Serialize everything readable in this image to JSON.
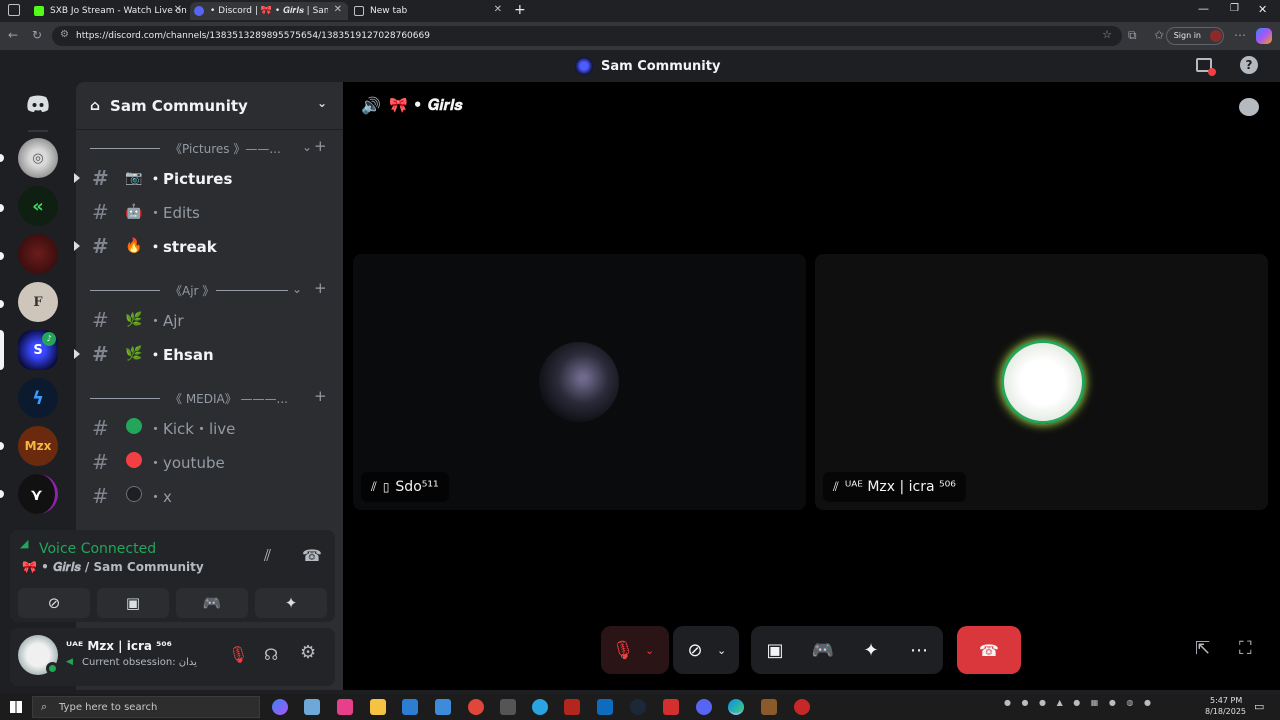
{
  "browser": {
    "tabs": [
      {
        "title": "SXB Jo Stream - Watch Live on",
        "active": false
      },
      {
        "title": "• Discord | 🎀 • 𝑮𝒊𝒓𝒍𝒔 | Sam Comm",
        "active": true
      },
      {
        "title": "New tab",
        "active": false
      }
    ],
    "url": "https://discord.com/channels/1383513289895575654/1383519127028760669",
    "sign_in": "Sign in"
  },
  "titlebar": {
    "server_name": "Sam Community"
  },
  "sidebar": {
    "server_name": "Sam Community",
    "categories": [
      {
        "label": "《Pictures 》——..."
      },
      {
        "label": "《Ajr 》"
      },
      {
        "label": "《 MEDIA》 ———..."
      }
    ],
    "channels": [
      {
        "emoji": "📷",
        "name": "・Pictures",
        "bold": true,
        "unread": true
      },
      {
        "emoji": "🤖",
        "name": "・Edits",
        "bold": false,
        "unread": false
      },
      {
        "emoji": "🔥",
        "name": "・streak",
        "bold": true,
        "unread": true
      },
      {
        "emoji": "🌿",
        "name": "・Ajr",
        "bold": false,
        "unread": false
      },
      {
        "emoji": "🌿",
        "name": "・Ehsan",
        "bold": true,
        "unread": true
      },
      {
        "emoji": "",
        "name": "・Kick・live",
        "bold": false,
        "unread": false,
        "dot_color": "#23a55a"
      },
      {
        "emoji": "",
        "name": "・youtube",
        "bold": false,
        "unread": false,
        "dot_color": "#f23f43"
      },
      {
        "emoji": "",
        "name": "・x",
        "bold": false,
        "unread": false,
        "dot_color": "#1e1f22"
      }
    ]
  },
  "voice": {
    "status": "Voice Connected",
    "location": "🎀 • 𝑮𝒊𝒓𝒍𝒔 / Sam Community",
    "status_color": "#23a55a"
  },
  "user": {
    "name": "ᵁᴬᴱ Mzx | icra ⁵⁰⁶",
    "status": "Current obsession: یدان"
  },
  "stage": {
    "channel_title": "🎀 • 𝑮𝒊𝒓𝒍𝒔",
    "participants": [
      {
        "name": "Sdo⁵¹¹",
        "muted": true,
        "mobile": true
      },
      {
        "name": "ᵁᴬᴱ Mzx | icra ⁵⁰⁶",
        "muted": true,
        "mobile": false
      }
    ]
  },
  "taskbar": {
    "search_placeholder": "Type here to search",
    "time": "5:47 PM",
    "date": "8/18/2025"
  },
  "colors": {
    "accent": "#5865f2",
    "danger": "#da373c",
    "online": "#23a55a"
  }
}
